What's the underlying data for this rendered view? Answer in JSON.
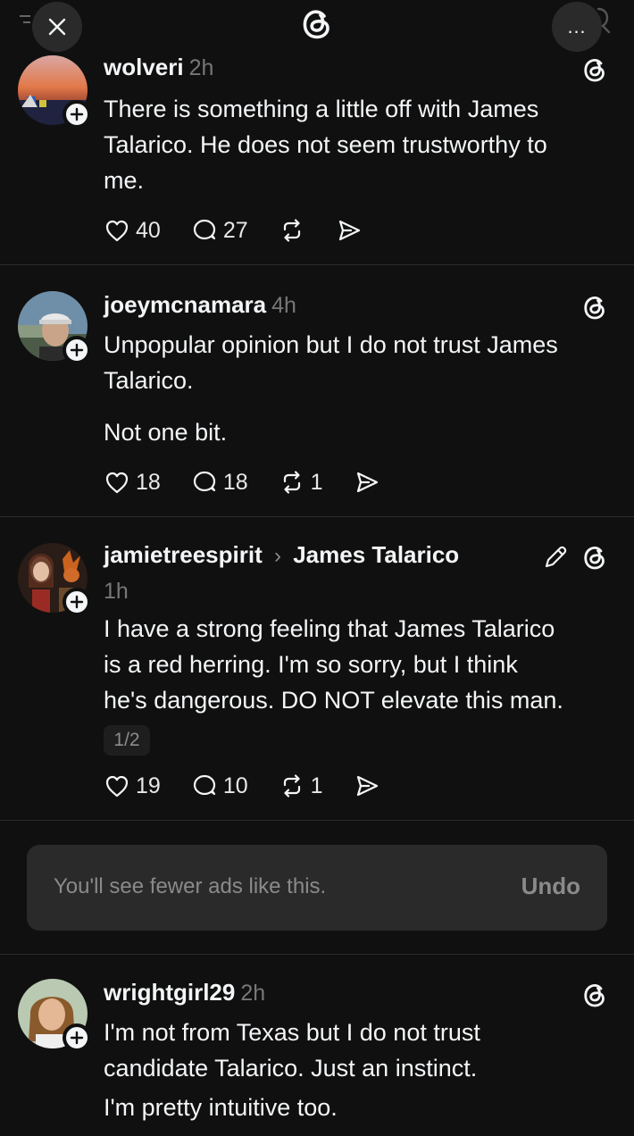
{
  "header": {
    "close_icon": "close-icon",
    "logo_icon": "threads-logo-icon",
    "more_label": "…"
  },
  "posts": [
    {
      "username": "wolveri",
      "time": "2h",
      "lines": [
        "There is something a little off with James",
        "Talarico. He does not seem trustworthy to",
        "me."
      ],
      "likes": "40",
      "replies": "27",
      "reposts": "",
      "avatar": "sunset-avatar"
    },
    {
      "username": "joeymcnamara",
      "time": "4h",
      "lines": [
        "Unpopular opinion but I do not trust James",
        "Talarico."
      ],
      "extra_paragraph": "Not one bit.",
      "likes": "18",
      "replies": "18",
      "reposts": "1",
      "avatar": "man-in-cap-avatar"
    },
    {
      "username": "jamietreespirit",
      "reply_to": "James Talarico",
      "time": "1h",
      "lines": [
        "I have a strong feeling that James Talarico",
        "is a red herring. I'm so sorry, but I think",
        "he's dangerous. DO NOT elevate this man."
      ],
      "page_indicator": "1/2",
      "likes": "19",
      "replies": "10",
      "reposts": "1",
      "avatar": "art-collage-avatar"
    },
    {
      "username": "wrightgirl29",
      "time": "2h",
      "lines": [
        "I'm not from Texas but I do not trust",
        "candidate Talarico. Just an instinct.",
        "I'm pretty intuitive too."
      ],
      "avatar": "woman-portrait-avatar"
    }
  ],
  "ad_notice": {
    "text": "You'll see fewer ads like this.",
    "undo_label": "Undo"
  },
  "colors": {
    "background": "#101010",
    "text": "#f3f5f7",
    "muted": "#777777",
    "divider": "#2b2b2b"
  }
}
